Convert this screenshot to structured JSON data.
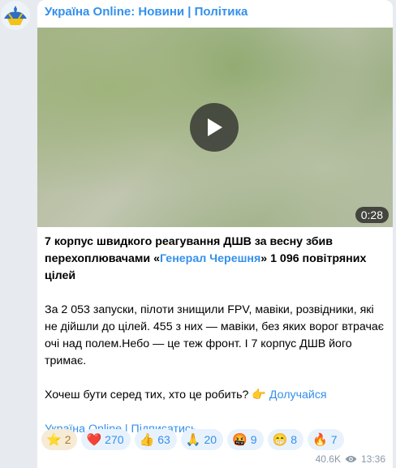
{
  "channel": {
    "name": "Україна Online: Новини | Політика"
  },
  "video": {
    "duration": "0:28"
  },
  "post": {
    "headline_pre": "7 корпус швидкого реагування ДШВ за весну збив перехоплювачами «",
    "headline_link": "Генерал Черешня",
    "headline_post": "» 1 096 повітряних цілей",
    "body": "За 2 053 запуски, пілоти знищили FPV, мавіки, розвідники, які не дійшли до цілей. 455 з них — мавіки, без яких ворог втрачає очі над полем.Небо — це теж фронт. І 7 корпус ДШВ його тримає.",
    "cta_text": "Хочеш бути серед тих, хто це робить? 👉 ",
    "cta_link": "Долучайся",
    "subscribe": "Україна Online | Підписатись"
  },
  "reactions": [
    {
      "emoji": "⭐",
      "icon": "star-icon",
      "count": "2"
    },
    {
      "emoji": "❤️",
      "icon": "heart-icon",
      "count": "270"
    },
    {
      "emoji": "👍",
      "icon": "thumbs-up-icon",
      "count": "63"
    },
    {
      "emoji": "🙏",
      "icon": "pray-icon",
      "count": "20"
    },
    {
      "emoji": "🤬",
      "icon": "angry-icon",
      "count": "9"
    },
    {
      "emoji": "😁",
      "icon": "grin-icon",
      "count": "8"
    },
    {
      "emoji": "🔥",
      "icon": "fire-icon",
      "count": "7"
    }
  ],
  "footer": {
    "views": "40.6K",
    "time": "13:36"
  },
  "colors": {
    "accent": "#3390ec",
    "bubble": "#ffffff",
    "background": "#e7ebf0"
  }
}
